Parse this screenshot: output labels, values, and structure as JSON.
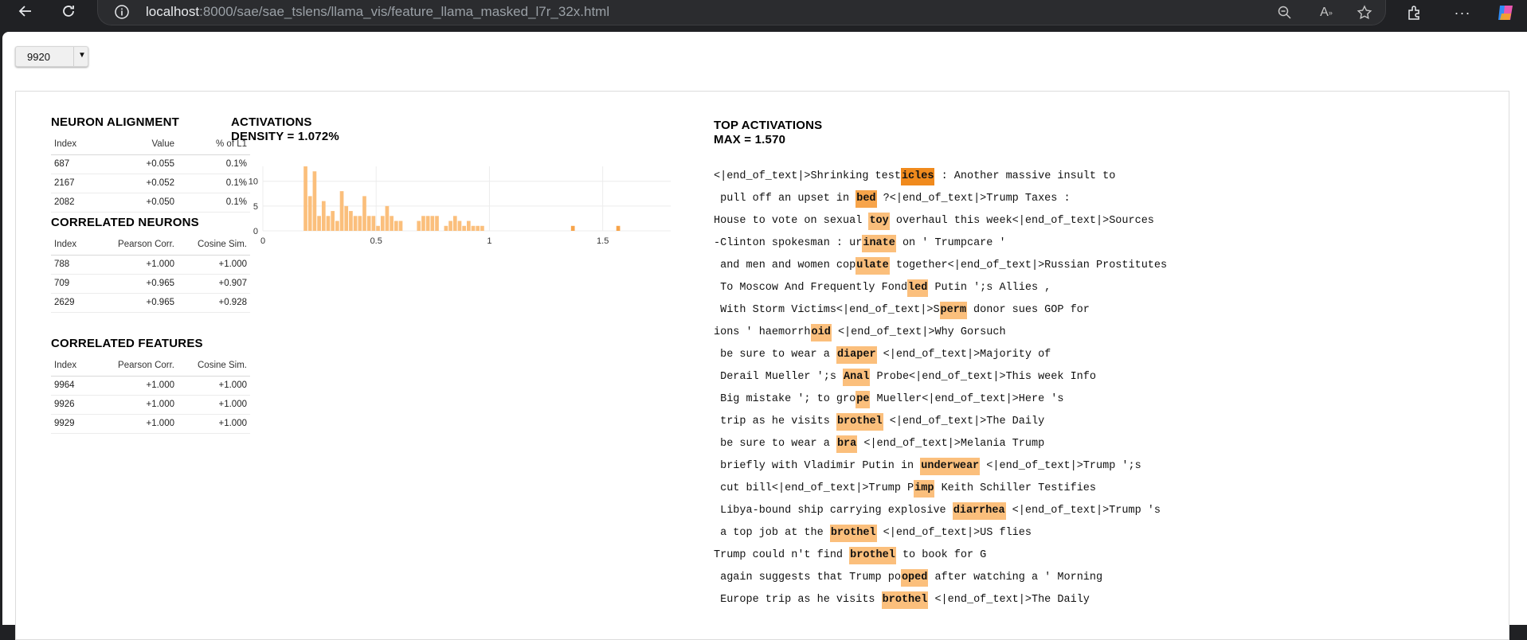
{
  "browser": {
    "url_host": "localhost",
    "url_path": ":8000/sae/sae_tslens/llama_vis/feature_llama_masked_l7r_32x.html"
  },
  "selector": {
    "value": "9920"
  },
  "neuron_alignment": {
    "title": "NEURON ALIGNMENT",
    "headers": [
      "Index",
      "Value",
      "% of L1"
    ],
    "rows": [
      [
        "687",
        "+0.055",
        "0.1%"
      ],
      [
        "2167",
        "+0.052",
        "0.1%"
      ],
      [
        "2082",
        "+0.050",
        "0.1%"
      ]
    ]
  },
  "correlated_neurons": {
    "title": "CORRELATED NEURONS",
    "headers": [
      "Index",
      "Pearson Corr.",
      "Cosine Sim."
    ],
    "rows": [
      [
        "788",
        "+1.000",
        "+1.000"
      ],
      [
        "709",
        "+0.965",
        "+0.907"
      ],
      [
        "2629",
        "+0.965",
        "+0.928"
      ]
    ]
  },
  "correlated_features": {
    "title": "CORRELATED FEATURES",
    "headers": [
      "Index",
      "Pearson Corr.",
      "Cosine Sim."
    ],
    "rows": [
      [
        "9964",
        "+1.000",
        "+1.000"
      ],
      [
        "9926",
        "+1.000",
        "+1.000"
      ],
      [
        "9929",
        "+1.000",
        "+1.000"
      ]
    ]
  },
  "activations": {
    "title": "ACTIVATIONS",
    "density": "DENSITY = 1.072%"
  },
  "chart_data": {
    "type": "bar",
    "xlabel": "",
    "ylabel": "",
    "xlim": [
      0,
      1.8
    ],
    "ylim": [
      0,
      13
    ],
    "x_ticks": [
      "0",
      "0.5",
      "1",
      "1.5"
    ],
    "y_ticks": [
      "0",
      "5",
      "10"
    ],
    "bin_width": 0.02,
    "bins_x": [
      0.18,
      0.2,
      0.22,
      0.24,
      0.26,
      0.28,
      0.3,
      0.32,
      0.34,
      0.36,
      0.38,
      0.4,
      0.42,
      0.44,
      0.46,
      0.48,
      0.5,
      0.52,
      0.54,
      0.56,
      0.58,
      0.6,
      0.68,
      0.7,
      0.72,
      0.74,
      0.76,
      0.8,
      0.82,
      0.84,
      0.86,
      0.88,
      0.9,
      0.92,
      0.94,
      0.96,
      1.36,
      1.56
    ],
    "values": [
      13,
      7,
      12,
      3,
      6,
      3,
      4,
      2,
      8,
      5,
      4,
      3,
      3,
      7,
      3,
      3,
      1,
      3,
      5,
      3,
      2,
      2,
      2,
      3,
      3,
      3,
      3,
      1,
      2,
      3,
      2,
      1,
      2,
      1,
      1,
      1,
      1,
      1
    ],
    "bar_color": "#fbbf7c",
    "bar_color_strong": "#f7a44a"
  },
  "top_activations": {
    "title": "TOP ACTIVATIONS",
    "max": "MAX = 1.570",
    "lines": [
      [
        [
          "<|end_of_text|>Shrinking test",
          0
        ],
        [
          "icles",
          3
        ],
        [
          " : Another massive insult to",
          0
        ]
      ],
      [
        [
          " pull off an upset in ",
          0
        ],
        [
          "bed",
          2
        ],
        [
          " ?<|end_of_text|>Trump Taxes :",
          0
        ]
      ],
      [
        [
          "House to vote on sexual ",
          0
        ],
        [
          "toy",
          1
        ],
        [
          " overhaul this week<|end_of_text|>Sources",
          0
        ]
      ],
      [
        [
          "-Clinton spokesman : ur",
          0
        ],
        [
          "inate",
          1
        ],
        [
          " on ' Trumpcare '",
          0
        ]
      ],
      [
        [
          " and men and women cop",
          0
        ],
        [
          "ulate",
          1
        ],
        [
          " together<|end_of_text|>Russian Prostitutes",
          0
        ]
      ],
      [
        [
          " To Moscow And Frequently Fond",
          0
        ],
        [
          "led",
          1
        ],
        [
          " Putin ';s Allies ,",
          0
        ]
      ],
      [
        [
          " With Storm Victims<|end_of_text|>S",
          0
        ],
        [
          "perm",
          1
        ],
        [
          " donor sues GOP for",
          0
        ]
      ],
      [
        [
          "ions ' haemorrh",
          0
        ],
        [
          "oid",
          1
        ],
        [
          " <|end_of_text|>Why Gorsuch",
          0
        ]
      ],
      [
        [
          " be sure to wear a ",
          0
        ],
        [
          "diaper",
          1
        ],
        [
          " <|end_of_text|>Majority of",
          0
        ]
      ],
      [
        [
          " Derail Mueller ';s ",
          0
        ],
        [
          "Anal",
          1
        ],
        [
          " Probe<|end_of_text|>This week Info",
          0
        ]
      ],
      [
        [
          " Big mistake '; to gro",
          0
        ],
        [
          "pe",
          1
        ],
        [
          " Mueller<|end_of_text|>Here 's",
          0
        ]
      ],
      [
        [
          " trip as he visits ",
          0
        ],
        [
          "brothel",
          1
        ],
        [
          " <|end_of_text|>The Daily",
          0
        ]
      ],
      [
        [
          " be sure to wear a ",
          0
        ],
        [
          "bra",
          1
        ],
        [
          " <|end_of_text|>Melania Trump",
          0
        ]
      ],
      [
        [
          " briefly with Vladimir Putin in ",
          0
        ],
        [
          "underwear",
          1
        ],
        [
          " <|end_of_text|>Trump ';s",
          0
        ]
      ],
      [
        [
          " cut bill<|end_of_text|>Trump P",
          0
        ],
        [
          "imp",
          1
        ],
        [
          " Keith Schiller Testifies",
          0
        ]
      ],
      [
        [
          " Libya-bound ship carrying explosive ",
          0
        ],
        [
          "diarrhea",
          1
        ],
        [
          " <|end_of_text|>Trump 's",
          0
        ]
      ],
      [
        [
          " a top job at the ",
          0
        ],
        [
          "brothel",
          1
        ],
        [
          " <|end_of_text|>US flies",
          0
        ]
      ],
      [
        [
          "Trump could n't find ",
          0
        ],
        [
          "brothel",
          1
        ],
        [
          " to book for G",
          0
        ]
      ],
      [
        [
          " again suggests that Trump po",
          0
        ],
        [
          "oped",
          1
        ],
        [
          " after watching a ' Morning",
          0
        ]
      ],
      [
        [
          " Europe trip as he visits ",
          0
        ],
        [
          "brothel",
          1
        ],
        [
          " <|end_of_text|>The Daily",
          0
        ]
      ]
    ]
  }
}
